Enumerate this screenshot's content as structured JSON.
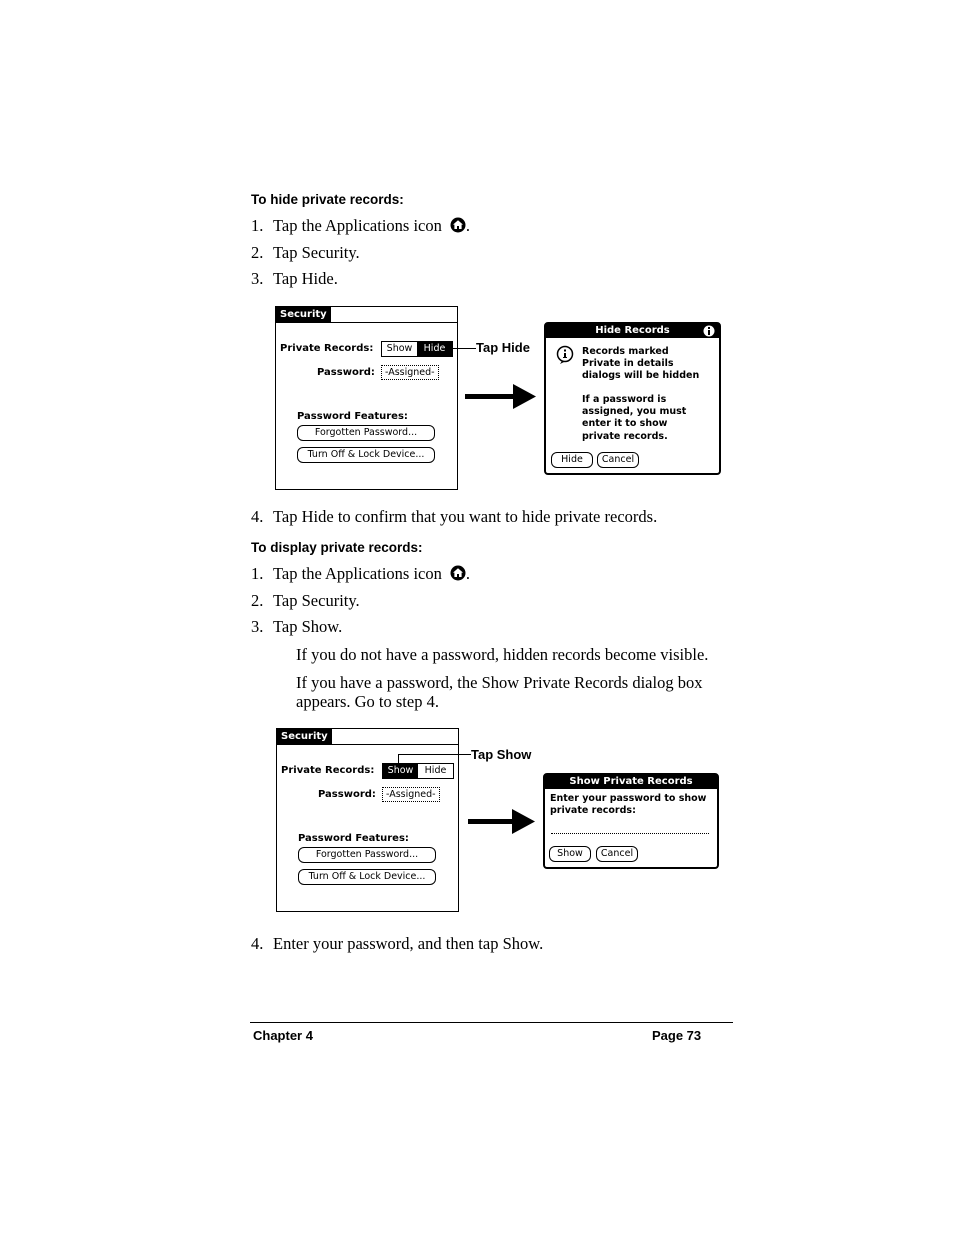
{
  "hide_section": {
    "heading": "To hide private records:",
    "steps": [
      {
        "num": "1.",
        "text": "Tap the Applications icon",
        "suffix": ".",
        "icon": "applications-home-icon"
      },
      {
        "num": "2.",
        "text": "Tap Security."
      },
      {
        "num": "3.",
        "text": "Tap Hide."
      },
      {
        "num": "4.",
        "text": "Tap Hide to confirm that you want to hide private records."
      }
    ],
    "figure": {
      "screen": {
        "title": "Security",
        "private_records_label": "Private Records:",
        "show_label": "Show",
        "hide_label": "Hide",
        "selected": "Hide",
        "password_label": "Password:",
        "password_value": "-Assigned-",
        "features_label": "Password Features:",
        "forgotten_button": "Forgotten Password...",
        "lock_button": "Turn Off & Lock Device..."
      },
      "callout": "Tap Hide",
      "dialog": {
        "title": "Hide Records",
        "lines1": [
          "Records marked",
          "Private in details",
          "dialogs will be hidden"
        ],
        "lines2": [
          "If a password is",
          "assigned, you must",
          "enter it to show",
          "private records."
        ],
        "hide_button": "Hide",
        "cancel_button": "Cancel"
      }
    }
  },
  "display_section": {
    "heading": "To display private records:",
    "steps": [
      {
        "num": "1.",
        "text": "Tap the Applications icon",
        "suffix": ".",
        "icon": "applications-home-icon"
      },
      {
        "num": "2.",
        "text": "Tap Security."
      },
      {
        "num": "3.",
        "text": "Tap Show."
      },
      {
        "num": "4.",
        "text": "Enter your password, and then tap Show."
      }
    ],
    "notes": [
      "If you do not have a password, hidden records become visible.",
      "If you have a password, the Show Private Records dialog box",
      "appears. Go to step 4."
    ],
    "figure": {
      "screen": {
        "title": "Security",
        "private_records_label": "Private Records:",
        "show_label": "Show",
        "hide_label": "Hide",
        "selected": "Show",
        "password_label": "Password:",
        "password_value": "-Assigned-",
        "features_label": "Password Features:",
        "forgotten_button": "Forgotten Password...",
        "lock_button": "Turn Off & Lock Device..."
      },
      "callout": "Tap Show",
      "dialog": {
        "title": "Show Private Records",
        "lines": [
          "Enter your password to show",
          "private records:"
        ],
        "show_button": "Show",
        "cancel_button": "Cancel"
      }
    }
  },
  "footer": {
    "chapter": "Chapter 4",
    "page": "Page 73"
  }
}
